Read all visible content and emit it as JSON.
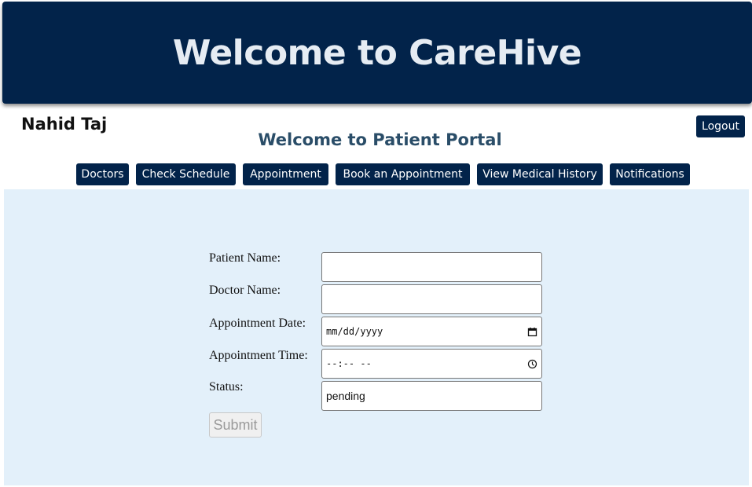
{
  "header": {
    "title": "Welcome to CareHive"
  },
  "user": {
    "name": "Nahid Taj",
    "logout_label": "Logout"
  },
  "portal": {
    "title": "Welcome to Patient Portal"
  },
  "nav": {
    "doctors": "Doctors",
    "check_schedule": "Check Schedule",
    "appointment": "Appointment",
    "book_appointment": "Book an Appointment",
    "medical_history": "View Medical History",
    "notifications": "Notifications"
  },
  "form": {
    "patient_name_label": "Patient Name:",
    "patient_name_value": "",
    "doctor_name_label": "Doctor Name:",
    "doctor_name_value": "",
    "date_label": "Appointment Date:",
    "date_placeholder": "mm/dd/yyyy",
    "date_icon": "calendar-icon",
    "time_label": "Appointment Time:",
    "time_placeholder": "--:-- --",
    "time_icon": "clock-icon",
    "status_label": "Status:",
    "status_value": "pending",
    "submit_label": "Submit"
  },
  "colors": {
    "brand_navy": "#02234a",
    "portal_title": "#2a4d68",
    "panel_background": "#e3f0fa"
  }
}
